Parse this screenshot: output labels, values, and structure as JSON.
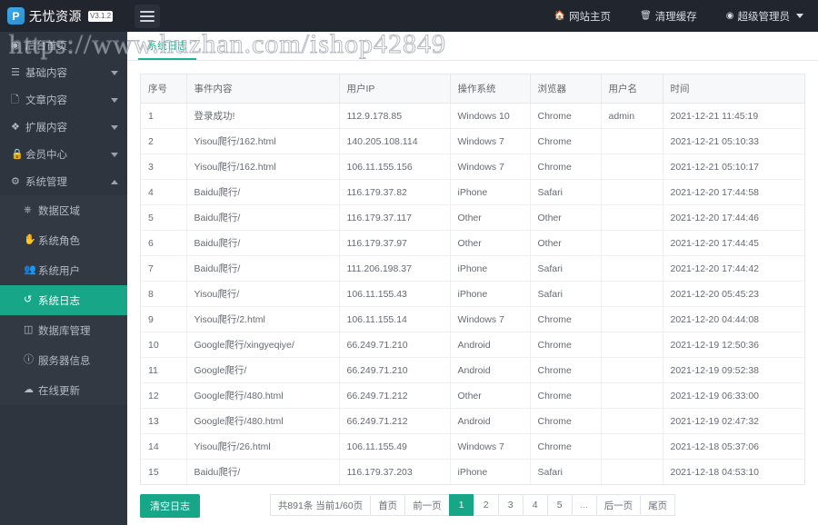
{
  "topbar": {
    "logo_glyph": "P",
    "brand_name": "无忧资源",
    "version_badge": "V3.1.2",
    "menu_toggle_icon": "hamburger-icon",
    "nav": [
      {
        "icon": "home-icon",
        "label": "网站主页"
      },
      {
        "icon": "trash-icon",
        "label": "清理缓存"
      },
      {
        "icon": "user-circle-icon",
        "label": "超级管理员",
        "has_caret": true
      }
    ]
  },
  "sidebar": {
    "items": [
      {
        "icon": "dashboard-icon",
        "label": "后台首页",
        "has_arrow": false,
        "obscured": true
      },
      {
        "icon": "layers-icon",
        "label": "基础内容",
        "has_arrow": true,
        "arrow": "down"
      },
      {
        "icon": "file-icon",
        "label": "文章内容",
        "has_arrow": true,
        "arrow": "down"
      },
      {
        "icon": "puzzle-icon",
        "label": "扩展内容",
        "has_arrow": true,
        "arrow": "down"
      },
      {
        "icon": "lock-icon",
        "label": "会员中心",
        "has_arrow": true,
        "arrow": "down"
      },
      {
        "icon": "gear-icon",
        "label": "系统管理",
        "has_arrow": true,
        "arrow": "up",
        "expanded": true
      }
    ],
    "submenu": [
      {
        "icon": "sitemap-icon",
        "label": "数据区域",
        "active": false
      },
      {
        "icon": "hand-icon",
        "label": "系统角色",
        "active": false
      },
      {
        "icon": "users-icon",
        "label": "系统用户",
        "active": false
      },
      {
        "icon": "history-icon",
        "label": "系统日志",
        "active": true
      },
      {
        "icon": "database-icon",
        "label": "数据库管理",
        "active": false
      },
      {
        "icon": "info-icon",
        "label": "服务器信息",
        "active": false
      },
      {
        "icon": "cloud-icon",
        "label": "在线更新",
        "active": false
      }
    ]
  },
  "main": {
    "tab_label": "系统日志",
    "clear_button_label": "清空日志",
    "columns": [
      "序号",
      "事件内容",
      "用户IP",
      "操作系统",
      "浏览器",
      "用户名",
      "时间"
    ],
    "rows": [
      [
        "1",
        "登录成功!",
        "112.9.178.85",
        "Windows 10",
        "Chrome",
        "admin",
        "2021-12-21 11:45:19"
      ],
      [
        "2",
        "Yisou爬行/162.html",
        "140.205.108.114",
        "Windows 7",
        "Chrome",
        "",
        "2021-12-21 05:10:33"
      ],
      [
        "3",
        "Yisou爬行/162.html",
        "106.11.155.156",
        "Windows 7",
        "Chrome",
        "",
        "2021-12-21 05:10:17"
      ],
      [
        "4",
        "Baidu爬行/",
        "116.179.37.82",
        "iPhone",
        "Safari",
        "",
        "2021-12-20 17:44:58"
      ],
      [
        "5",
        "Baidu爬行/",
        "116.179.37.117",
        "Other",
        "Other",
        "",
        "2021-12-20 17:44:46"
      ],
      [
        "6",
        "Baidu爬行/",
        "116.179.37.97",
        "Other",
        "Other",
        "",
        "2021-12-20 17:44:45"
      ],
      [
        "7",
        "Baidu爬行/",
        "111.206.198.37",
        "iPhone",
        "Safari",
        "",
        "2021-12-20 17:44:42"
      ],
      [
        "8",
        "Yisou爬行/",
        "106.11.155.43",
        "iPhone",
        "Safari",
        "",
        "2021-12-20 05:45:23"
      ],
      [
        "9",
        "Yisou爬行/2.html",
        "106.11.155.14",
        "Windows 7",
        "Chrome",
        "",
        "2021-12-20 04:44:08"
      ],
      [
        "10",
        "Google爬行/xingyeqiye/",
        "66.249.71.210",
        "Android",
        "Chrome",
        "",
        "2021-12-19 12:50:36"
      ],
      [
        "11",
        "Google爬行/",
        "66.249.71.210",
        "Android",
        "Chrome",
        "",
        "2021-12-19 09:52:38"
      ],
      [
        "12",
        "Google爬行/480.html",
        "66.249.71.212",
        "Other",
        "Chrome",
        "",
        "2021-12-19 06:33:00"
      ],
      [
        "13",
        "Google爬行/480.html",
        "66.249.71.212",
        "Android",
        "Chrome",
        "",
        "2021-12-19 02:47:32"
      ],
      [
        "14",
        "Yisou爬行/26.html",
        "106.11.155.49",
        "Windows 7",
        "Chrome",
        "",
        "2021-12-18 05:37:06"
      ],
      [
        "15",
        "Baidu爬行/",
        "116.179.37.203",
        "iPhone",
        "Safari",
        "",
        "2021-12-18 04:53:10"
      ]
    ]
  },
  "pagination": {
    "summary": "共891条 当前1/60页",
    "first_label": "首页",
    "prev_label": "前一页",
    "pages": [
      "1",
      "2",
      "3",
      "4",
      "5"
    ],
    "ellipsis": "...",
    "next_label": "后一页",
    "last_label": "尾页",
    "current_page": "1"
  },
  "watermark": {
    "text": "https://www.huzhan.com/ishop42849"
  },
  "colors": {
    "accent_green": "#18a689",
    "sidebar_bg": "#2f353f",
    "topbar_bg": "#21252e",
    "logo_blue": "#3fa9e8"
  }
}
